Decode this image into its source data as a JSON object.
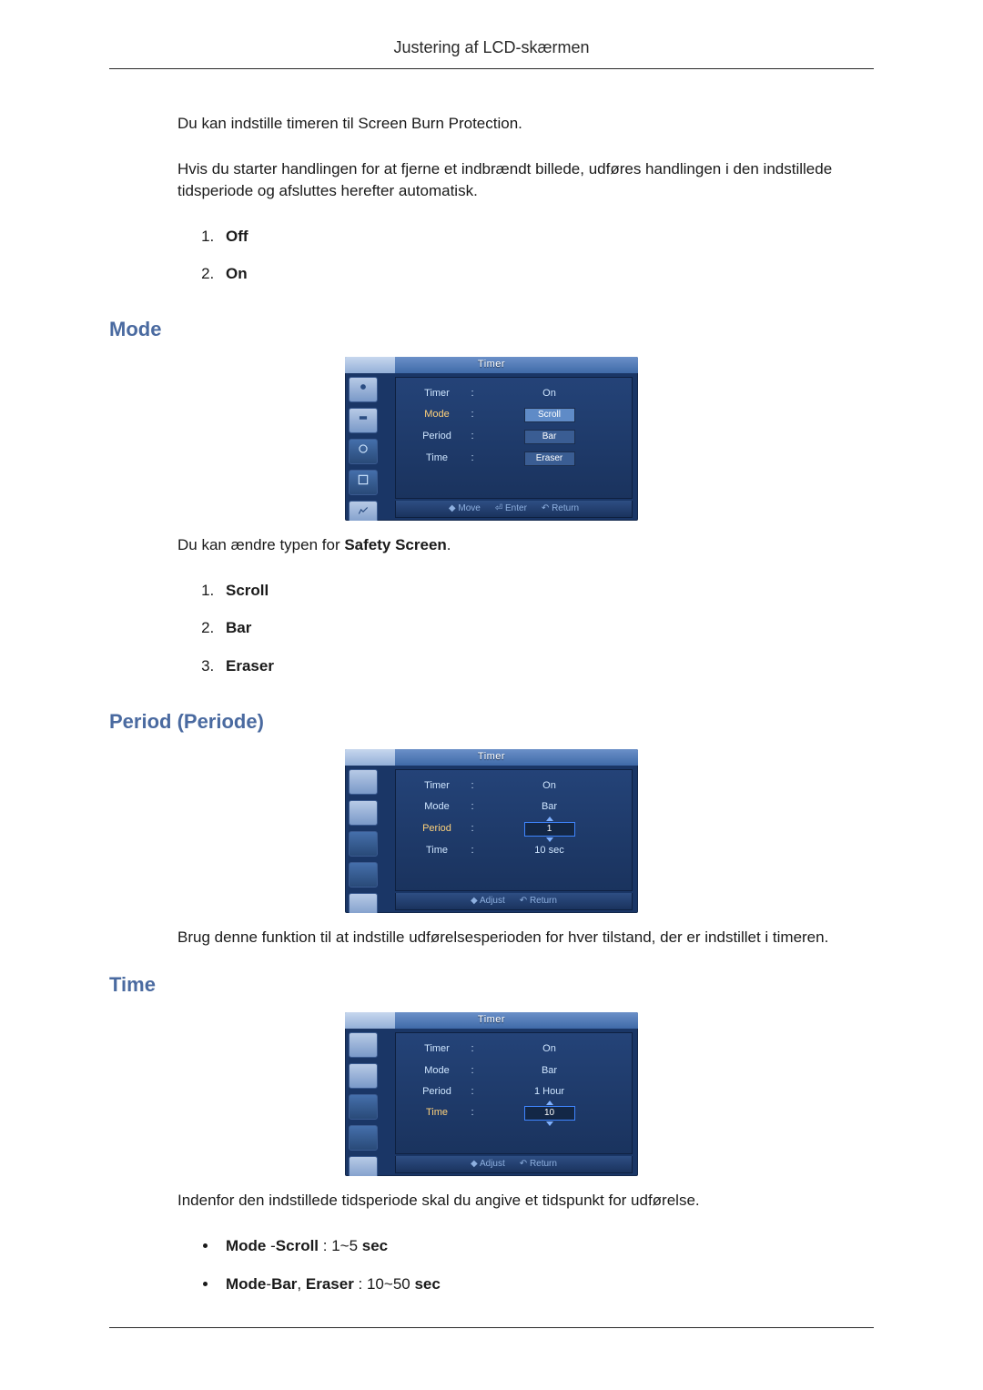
{
  "header": {
    "title": "Justering af LCD-skærmen"
  },
  "intro": {
    "p1": "Du kan indstille timeren til Screen Burn Protection.",
    "p2": "Hvis du starter handlingen for at fjerne et indbrændt billede, udføres handlingen i den indstillede tidsperiode og afsluttes herefter automatisk."
  },
  "timerStates": {
    "items": [
      "Off",
      "On"
    ]
  },
  "mode": {
    "heading": "Mode",
    "desc_pre": "Du kan ændre typen for ",
    "desc_b": "Safety Screen",
    "desc_post": ".",
    "items": [
      "Scroll",
      "Bar",
      "Eraser"
    ]
  },
  "period": {
    "heading": "Period (Periode)",
    "desc": "Brug denne funktion til at indstille udførelsesperioden for hver tilstand, der er indstillet i timeren."
  },
  "time": {
    "heading": "Time",
    "desc": "Indenfor den indstillede tidsperiode skal du angive et tidspunkt for udførelse.",
    "bullets": [
      {
        "b1": "Mode",
        "mid": " -",
        "b2": "Scroll",
        "post1": " : 1~5 ",
        "b3": "sec",
        "post2": ""
      },
      {
        "b1": "Mode",
        "mid": "-",
        "b2": "Bar",
        "comma": ", ",
        "b2b": "Eraser",
        "post1": " : 10~50 ",
        "b3": "sec",
        "post2": ""
      }
    ]
  },
  "osd": {
    "title": "Timer",
    "labels": {
      "timer": "Timer",
      "mode": "Mode",
      "period": "Period",
      "time": "Time"
    },
    "footerHints": {
      "move": "Move",
      "enter": "Enter",
      "return": "Return",
      "adjust": "Adjust"
    },
    "s1": {
      "timer": "On",
      "highlight": "mode",
      "options": [
        "Scroll",
        "Bar",
        "Eraser"
      ]
    },
    "s2": {
      "timer": "On",
      "mode": "Bar",
      "period": "1",
      "time": "10 sec",
      "highlight": "period"
    },
    "s3": {
      "timer": "On",
      "mode": "Bar",
      "period": "1 Hour",
      "time": "10",
      "highlight": "time"
    }
  }
}
